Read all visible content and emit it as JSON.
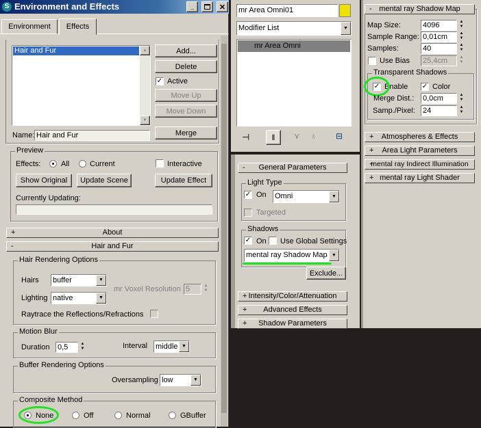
{
  "env_dialog": {
    "title": "Environment and Effects",
    "tabs": [
      "Environment",
      "Effects"
    ],
    "effects_group_title": "Effects",
    "effects_list": [
      "Hair and Fur"
    ],
    "buttons": {
      "add": "Add...",
      "delete": "Delete",
      "move_up": "Move Up",
      "move_down": "Move Down",
      "merge": "Merge"
    },
    "active_label": "Active",
    "name_label": "Name:",
    "name_value": "Hair and Fur",
    "preview": {
      "title": "Preview",
      "effects_label": "Effects:",
      "all_label": "All",
      "current_label": "Current",
      "interactive_label": "Interactive",
      "show_original": "Show Original",
      "update_scene": "Update Scene",
      "update_effect": "Update Effect",
      "currently_updating": "Currently Updating:"
    },
    "rollouts": {
      "about": "About",
      "hair_and_fur": "Hair and Fur"
    },
    "hair_rendering": {
      "title": "Hair Rendering Options",
      "hairs_label": "Hairs",
      "hairs_value": "buffer",
      "lighting_label": "Lighting",
      "lighting_value": "native",
      "voxel_label": "mr Voxel Resolution",
      "voxel_value": "5",
      "raytrace_label": "Raytrace the Reflections/Refractions"
    },
    "motion_blur": {
      "title": "Motion Blur",
      "duration_label": "Duration",
      "duration_value": "0,5",
      "interval_label": "Interval",
      "interval_value": "middle"
    },
    "buffer_rendering": {
      "title": "Buffer Rendering Options",
      "oversampling_label": "Oversampling",
      "oversampling_value": "low"
    },
    "composite": {
      "title": "Composite Method",
      "options": [
        "None",
        "Off",
        "Normal",
        "GBuffer"
      ],
      "selected": "None"
    }
  },
  "modify_panel": {
    "object_name": "mr Area Omni01",
    "object_color": "#f0e000",
    "modifier_list": "Modifier List",
    "stack_item": "mr Area Omni",
    "general_parameters": "General Parameters",
    "light_type": {
      "title": "Light Type",
      "on_label": "On",
      "type_value": "Omni",
      "targeted_label": "Targeted"
    },
    "shadows": {
      "title": "Shadows",
      "on_label": "On",
      "global_label": "Use Global Settings",
      "type_value": "mental ray Shadow Map",
      "exclude": "Exclude..."
    },
    "rollouts": [
      "Intensity/Color/Attenuation",
      "Advanced Effects",
      "Shadow Parameters"
    ]
  },
  "shadow_map_panel": {
    "title": "mental ray Shadow Map",
    "map_size_label": "Map Size:",
    "map_size_value": "4096",
    "sample_range_label": "Sample Range:",
    "sample_range_value": "0,01cm",
    "samples_label": "Samples:",
    "samples_value": "40",
    "use_bias_label": "Use Bias",
    "use_bias_value": "25,4cm",
    "transparent": {
      "title": "Transparent Shadows",
      "enable_label": "Enable",
      "color_label": "Color",
      "merge_label": "Merge Dist.:",
      "merge_value": "0,0cm",
      "samp_label": "Samp./Pixel:",
      "samp_value": "24"
    },
    "rollouts": [
      "Atmospheres & Effects",
      "Area Light Parameters",
      "mental ray Indirect Illumination",
      "mental ray Light Shader"
    ]
  },
  "icons": [
    "app-icon",
    "minimize-icon",
    "maximize-icon",
    "close-icon",
    "pin-stack-icon",
    "show-end-result-icon",
    "make-unique-icon",
    "remove-modifier-icon",
    "configure-sets-icon"
  ],
  "colors": {
    "title_bar": "#0a246a",
    "title_bar_end": "#a6caf0",
    "panel": "#d4d0c8",
    "selection": "#316ac5",
    "highlight": "#22e022",
    "stack_bg": "#808080"
  }
}
